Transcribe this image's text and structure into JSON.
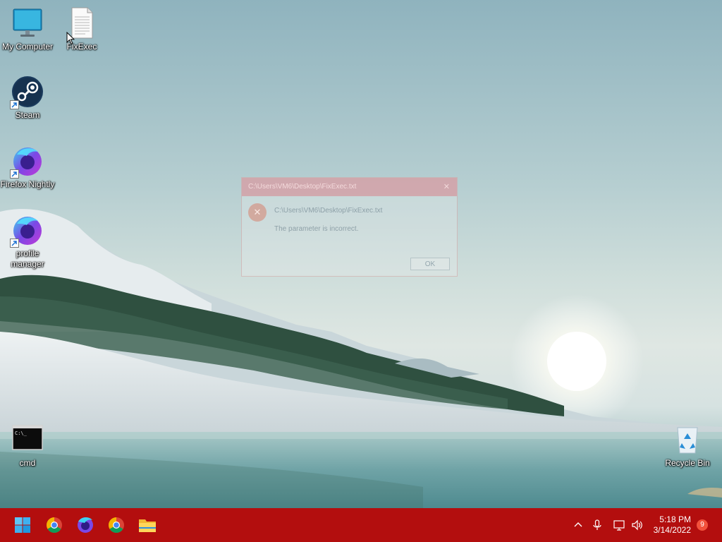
{
  "desktop": {
    "icons": [
      {
        "label": "My Computer"
      },
      {
        "label": "FixExec"
      },
      {
        "label": "Steam"
      },
      {
        "label": "Firefox Nightly"
      },
      {
        "label": "profile manager"
      },
      {
        "label": "cmd"
      },
      {
        "label": "Recycle Bin"
      }
    ]
  },
  "dialog": {
    "title": "C:\\Users\\VM6\\Desktop\\FixExec.txt",
    "path_text": "C:\\Users\\VM6\\Desktop\\FixExec.txt",
    "message": "The parameter is incorrect.",
    "ok_label": "OK",
    "close_glyph": "✕",
    "error_glyph": "✕"
  },
  "taskbar": {
    "apps": [
      {
        "name": "start-button",
        "icon": "windows-logo-icon"
      },
      {
        "name": "chrome",
        "icon": "chrome-icon"
      },
      {
        "name": "firefox",
        "icon": "firefox-icon"
      },
      {
        "name": "chrome-2",
        "icon": "chrome-icon"
      },
      {
        "name": "file-explorer",
        "icon": "folder-icon"
      }
    ],
    "tray": {
      "time": "5:18 PM",
      "date": "3/14/2022",
      "notification_count": "9"
    }
  },
  "colors": {
    "taskbar": "#b30e0e",
    "notification_badge": "#f2523c"
  }
}
